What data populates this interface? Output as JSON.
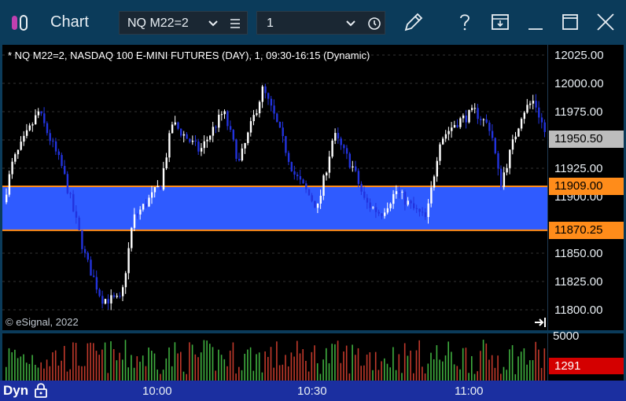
{
  "window": {
    "title": "Chart",
    "symbol": "NQ M22=2",
    "interval": "1"
  },
  "chart": {
    "header": "* NQ M22=2, NASDAQ 100 E-MINI FUTURES (DAY), 1, 09:30-16:15 (Dynamic)",
    "copyright": "© eSignal, 2022",
    "price_axis": [
      "12025.00",
      "12000.00",
      "11975.00",
      "11925.00",
      "11900.00",
      "11850.00",
      "11825.00",
      "11800.00"
    ],
    "last_price": "11950.50",
    "zone_top": "11909.00",
    "zone_bottom": "11870.25",
    "time_axis": [
      "10:00",
      "10:30",
      "11:00"
    ],
    "volume_axis_top": "5000",
    "volume_last": "1291",
    "bottom_label": "Dyn"
  },
  "colors": {
    "up_candle": "#ffffff",
    "down_candle": "#2233dd",
    "zone_fill": "#2f5bff",
    "zone_line": "#ff8c1a",
    "last_price_tag": "#bdbdbd",
    "volume_up": "#3fae3f",
    "volume_down": "#c0392b"
  },
  "icons": {
    "logo": "esignal-logo-icon",
    "chevron": "chevron-down-icon",
    "menu": "hamburger-menu-icon",
    "clock": "clock-icon",
    "pencil": "pencil-icon",
    "help": "question-icon",
    "save": "save-layout-icon",
    "minimize": "minimize-icon",
    "maximize": "maximize-icon",
    "close": "close-icon",
    "lock": "lock-icon",
    "scroll_end": "scroll-to-end-icon"
  }
}
